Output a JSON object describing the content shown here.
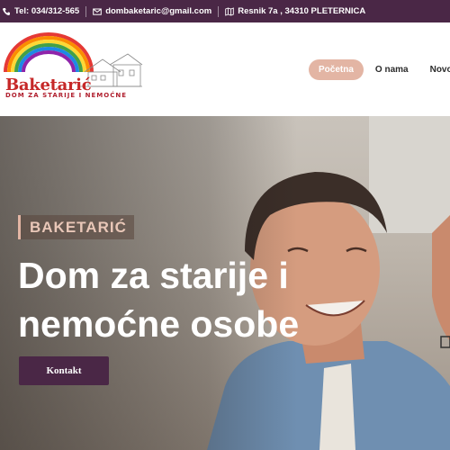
{
  "topbar": {
    "phone": "Tel: 034/312-565",
    "email": "dombaketaric@gmail.com",
    "address": "Resnik 7a , 34310 PLETERNICA",
    "icons": [
      "phone-icon",
      "envelope-icon",
      "map-icon"
    ]
  },
  "logo": {
    "name": "Baketarić",
    "subtitle": "DOM ZA STARIJE I NEMOĆNE"
  },
  "nav": {
    "items": [
      {
        "label": "Početna",
        "active": true
      },
      {
        "label": "O nama",
        "active": false
      },
      {
        "label": "Novosti",
        "active": false
      }
    ]
  },
  "hero": {
    "tag": "BAKETARIĆ",
    "title": "Dom za starije i nemoćne osobe",
    "cta": "Kontakt"
  },
  "colors": {
    "topbar": "#4a2746",
    "accent": "#e3b5a4",
    "button": "#4a2746",
    "logo_red": "#c62828"
  }
}
